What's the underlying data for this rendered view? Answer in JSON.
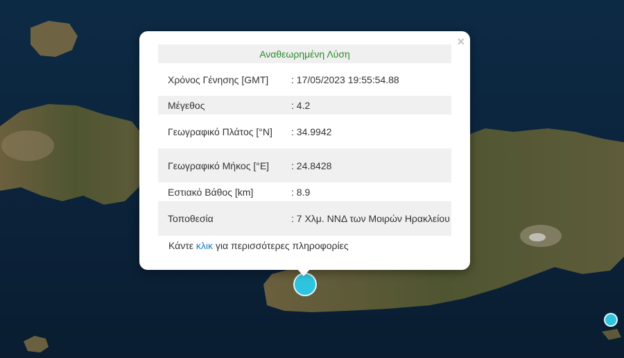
{
  "popup": {
    "close_icon": "close-icon",
    "header": "Αναθεωρημένη Λύση",
    "rows": [
      {
        "label": "Χρόνος Γένησης [GMT]",
        "value": ": 17/05/2023 19:55:54.88"
      },
      {
        "label": "Μέγεθος",
        "value": ": 4.2"
      },
      {
        "label": "Γεωγραφικό Πλάτος [°N]",
        "value": ": 34.9942"
      },
      {
        "label": "Γεωγραφικό Μήκος [°E]",
        "value": ": 24.8428"
      },
      {
        "label": "Εστιακό Βάθος [km]",
        "value": ": 8.9"
      },
      {
        "label": "Τοποθεσία",
        "value": ": 7 Χλμ. ΝΝΔ των Μοιρών Ηρακλείου"
      }
    ],
    "more_prefix": "Κάντε ",
    "more_link": "κλικ",
    "more_suffix": " για περισσότερες πληροφορίες"
  },
  "colors": {
    "sea": "#0c2238",
    "land": "#5a5a3c",
    "marker": "#2ec4df",
    "header_text": "#2b8a2b",
    "link": "#1a7bbf"
  }
}
